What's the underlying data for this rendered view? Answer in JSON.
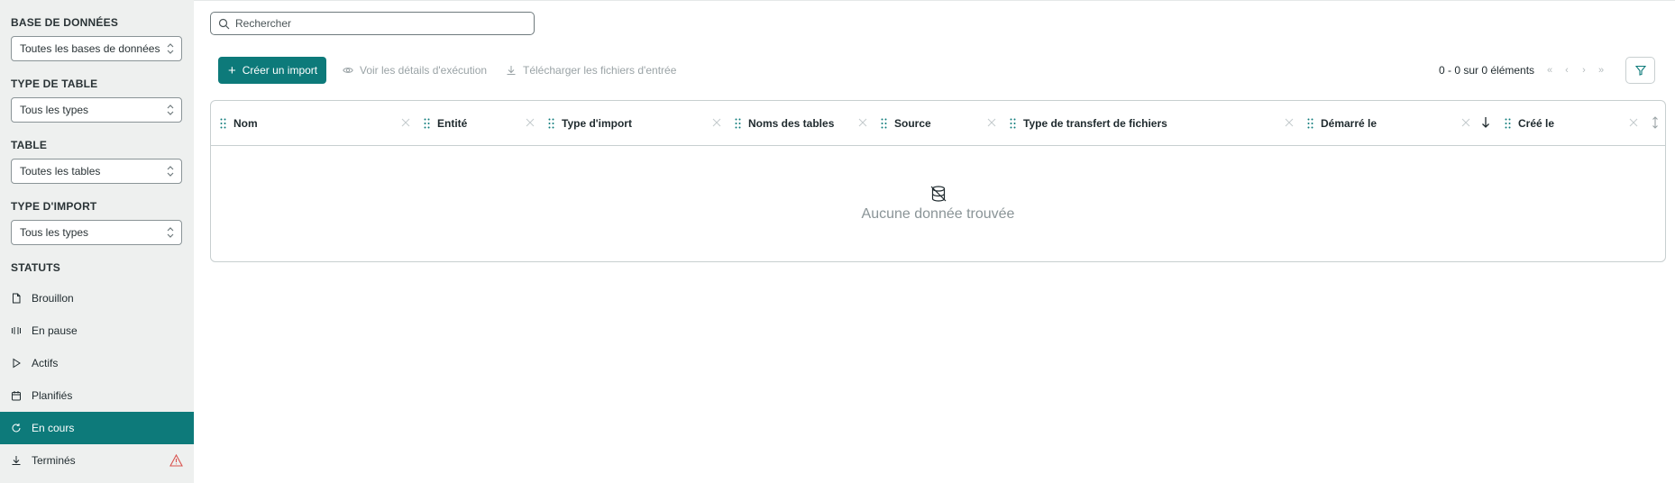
{
  "sidebar": {
    "filters": [
      {
        "label": "BASE DE DONNÉES",
        "value": "Toutes les bases de données"
      },
      {
        "label": "TYPE DE TABLE",
        "value": "Tous les types"
      },
      {
        "label": "TABLE",
        "value": "Toutes les tables"
      },
      {
        "label": "TYPE D'IMPORT",
        "value": "Tous les types"
      }
    ],
    "status_title": "STATUTS",
    "statuses": [
      {
        "label": "Brouillon",
        "icon": "document-icon"
      },
      {
        "label": "En pause",
        "icon": "pause-icon"
      },
      {
        "label": "Actifs",
        "icon": "play-icon"
      },
      {
        "label": "Planifiés",
        "icon": "calendar-icon"
      },
      {
        "label": "En cours",
        "icon": "refresh-icon",
        "active": true
      },
      {
        "label": "Terminés",
        "icon": "download-icon",
        "warning": true
      }
    ]
  },
  "search": {
    "placeholder": "Rechercher"
  },
  "toolbar": {
    "create_label": "Créer un import",
    "details_label": "Voir les détails d'exécution",
    "download_label": "Télécharger les fichiers d'entrée"
  },
  "pager": {
    "text": "0 - 0 sur 0 éléments"
  },
  "table": {
    "columns": [
      "Nom",
      "Entité",
      "Type d'import",
      "Noms des tables",
      "Source",
      "Type de transfert de fichiers",
      "Démarré le",
      "Créé le"
    ],
    "empty_text": "Aucune donnée trouvée"
  },
  "colors": {
    "accent": "#0d7a7a",
    "sidebar_bg": "#eef0ef"
  }
}
